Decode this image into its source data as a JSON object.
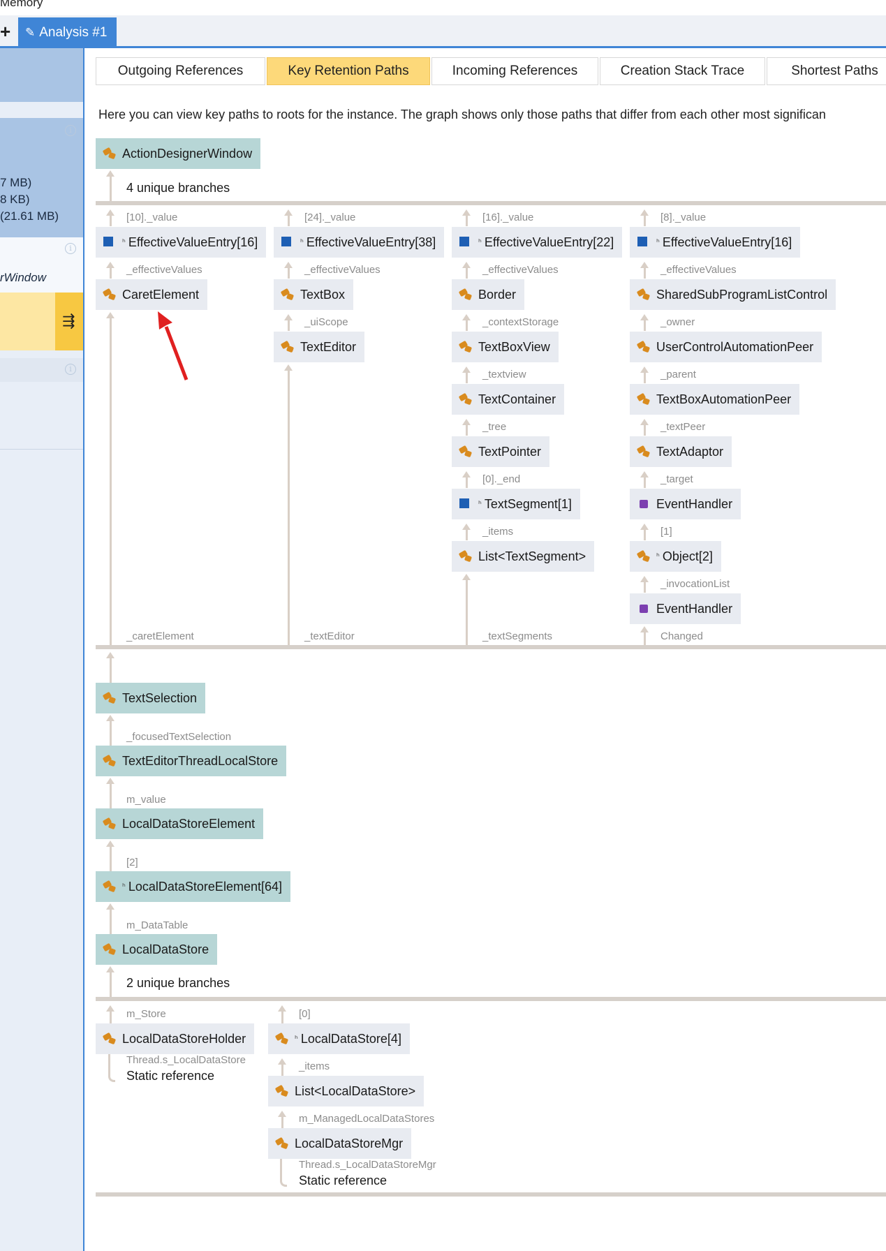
{
  "window": {
    "title": "Memory"
  },
  "tabs_bar": {
    "add_label": "+",
    "analysis_tab": "Analysis #1"
  },
  "left_pane": {
    "sizes": [
      "7 MB)",
      "8 KB)",
      "(21.61 MB)"
    ],
    "selected_text": "rWindow"
  },
  "subtabs": [
    "Outgoing References",
    "Key Retention Paths",
    "Incoming References",
    "Creation Stack Trace",
    "Shortest Paths"
  ],
  "active_subtab": "Key Retention Paths",
  "description": "Here you can view key paths to roots for the instance. The graph shows only those paths that differ from each other most significan",
  "graph": {
    "root": "ActionDesignerWindow",
    "branches1": "4 unique branches",
    "col1": {
      "top_label": "[10]._value",
      "n1": "EffectiveValueEntry[16]",
      "l1": "_effectiveValues",
      "n2": "CaretElement",
      "bottom_label": "_caretElement"
    },
    "col2": {
      "top_label": "[24]._value",
      "n1": "EffectiveValueEntry[38]",
      "l1": "_effectiveValues",
      "n2": "TextBox",
      "l2": "_uiScope",
      "n3": "TextEditor",
      "bottom_label": "_textEditor"
    },
    "col3": {
      "top_label": "[16]._value",
      "n1": "EffectiveValueEntry[22]",
      "l1": "_effectiveValues",
      "n2": "Border",
      "l2": "_contextStorage",
      "n3": "TextBoxView",
      "l3": "_textview",
      "n4": "TextContainer",
      "l4": "_tree",
      "n5": "TextPointer",
      "l5": "[0]._end",
      "n6": "TextSegment[1]",
      "l6": "_items",
      "n7": "List<TextSegment>",
      "bottom_label": "_textSegments"
    },
    "col4": {
      "top_label": "[8]._value",
      "n1": "EffectiveValueEntry[16]",
      "l1": "_effectiveValues",
      "n2": "SharedSubProgramListControl",
      "l2": "_owner",
      "n3": "UserControlAutomationPeer",
      "l3": "_parent",
      "n4": "TextBoxAutomationPeer",
      "l4": "_textPeer",
      "n5": "TextAdaptor",
      "l5": "_target",
      "n6": "EventHandler",
      "l6": "[1]",
      "n7": "Object[2]",
      "l7": "_invocationList",
      "n8": "EventHandler",
      "bottom_label": "Changed"
    },
    "chain": {
      "n1": "TextSelection",
      "l1": "_focusedTextSelection",
      "n2": "TextEditorThreadLocalStore",
      "l2": "m_value",
      "n3": "LocalDataStoreElement",
      "l3": "[2]",
      "n4": "LocalDataStoreElement[64]",
      "l4": "m_DataTable",
      "n5": "LocalDataStore"
    },
    "branches2": "2 unique branches",
    "b1": {
      "top_label": "m_Store",
      "n1": "LocalDataStoreHolder",
      "l1": "Thread.s_LocalDataStore",
      "static": "Static reference"
    },
    "b2": {
      "top_label": "[0]",
      "n1": "LocalDataStore[4]",
      "l1": "_items",
      "n2": "List<LocalDataStore>",
      "l2": "m_ManagedLocalDataStores",
      "n3": "LocalDataStoreMgr",
      "l3": "Thread.s_LocalDataStoreMgr",
      "static": "Static reference"
    }
  },
  "colors": {
    "accent": "#3f85d6",
    "active_tab": "#fdd97a",
    "root_node": "#b7d6d6",
    "node": "#e8ebf1",
    "annotation_arrow": "#e02020"
  }
}
